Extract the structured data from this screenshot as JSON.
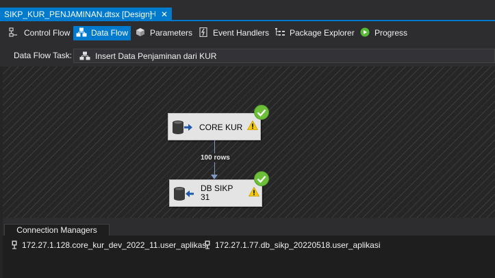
{
  "document_tab": {
    "title": "SIKP_KUR_PENJAMINAN.dtsx [Design]",
    "pin": "⊣",
    "close": "✕"
  },
  "designer_tabs": [
    {
      "label": "Control Flow",
      "icon": "control-flow-icon"
    },
    {
      "label": "Data Flow",
      "icon": "data-flow-icon"
    },
    {
      "label": "Parameters",
      "icon": "parameters-icon"
    },
    {
      "label": "Event Handlers",
      "icon": "event-handlers-icon"
    },
    {
      "label": "Package Explorer",
      "icon": "package-explorer-icon"
    },
    {
      "label": "Progress",
      "icon": "progress-play-icon"
    }
  ],
  "active_tab": "Data Flow",
  "data_flow_task": {
    "label": "Data Flow Task:",
    "value": "Insert Data Penjaminan dari KUR"
  },
  "canvas": {
    "source": {
      "name": "CORE KUR",
      "status": "success"
    },
    "path_label": "100 rows",
    "destination": {
      "name_line1": "DB SIKP",
      "name_line2": "31",
      "status": "success"
    }
  },
  "connection_managers": {
    "tab_label": "Connection Managers",
    "items": [
      "172.27.1.128.core_kur_dev_2022_11.user_aplikasi",
      "172.27.1.77.db_sikp_20220518.user_aplikasi"
    ]
  },
  "colors": {
    "accent": "#007acc",
    "success": "#6dbf3a",
    "warning": "#f2c811"
  }
}
